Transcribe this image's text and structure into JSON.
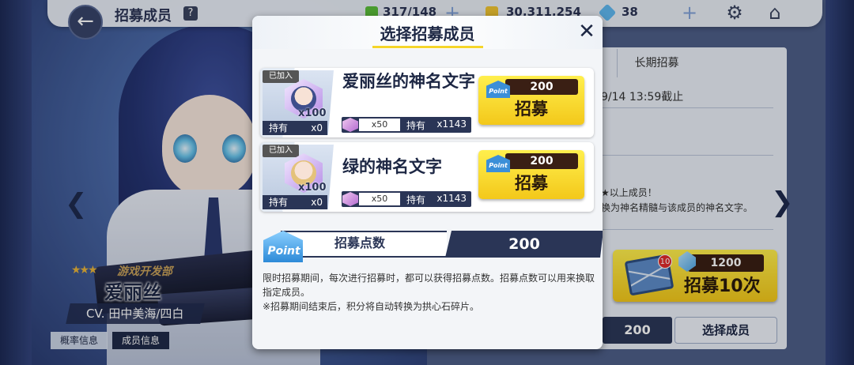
{
  "header": {
    "title": "招募成员",
    "help": "?",
    "stamina": "317/148",
    "gold": "30,311,254",
    "gems": "38",
    "back_icon": "back-arrow-icon",
    "settings_icon": "gear-icon",
    "home_icon": "home-icon"
  },
  "right_panel": {
    "tab_label": "长期招募",
    "deadline": "9/14 13:59截止",
    "notice_line1": "★以上成员！",
    "notice_line2": "换为神名精髓与该成员的神名文字。",
    "gacha10": {
      "badge": "10",
      "cost": "1200",
      "label": "招募10次"
    },
    "points_value": "200",
    "select_button": "选择成员"
  },
  "character": {
    "dept": "游戏开发部",
    "name": "爱丽丝",
    "cv": "CV. 田中美海/四白",
    "rate_info": "概率信息",
    "member_info": "成员信息"
  },
  "modal": {
    "title": "选择招募成员",
    "close_icon": "close-icon",
    "items": [
      {
        "joined": "已加入",
        "count_label": "x100",
        "own_label": "持有",
        "own_value": "x0",
        "name": "爱丽丝的神名文字",
        "frag_need": "x50",
        "frag_own_label": "持有",
        "frag_own_value": "x1143",
        "point_tag": "Point",
        "cost": "200",
        "button": "招募"
      },
      {
        "joined": "已加入",
        "count_label": "x100",
        "own_label": "持有",
        "own_value": "x0",
        "name": "绿的神名文字",
        "frag_need": "x50",
        "frag_own_label": "持有",
        "frag_own_value": "x1143",
        "point_tag": "Point",
        "cost": "200",
        "button": "招募"
      }
    ],
    "points": {
      "icon_text": "Point",
      "label": "招募点数",
      "value": "200"
    },
    "description_line1": "限时招募期间，每次进行招募时，都可以获得招募点数。招募点数可以用来换取指定成员。",
    "description_line2": "※招募期间结束后，积分将自动转换为拱心石碎片。"
  },
  "colors": {
    "accent_yellow": "#f5d52a",
    "navy": "#2a3556",
    "dark_brown": "#3a1f14"
  }
}
